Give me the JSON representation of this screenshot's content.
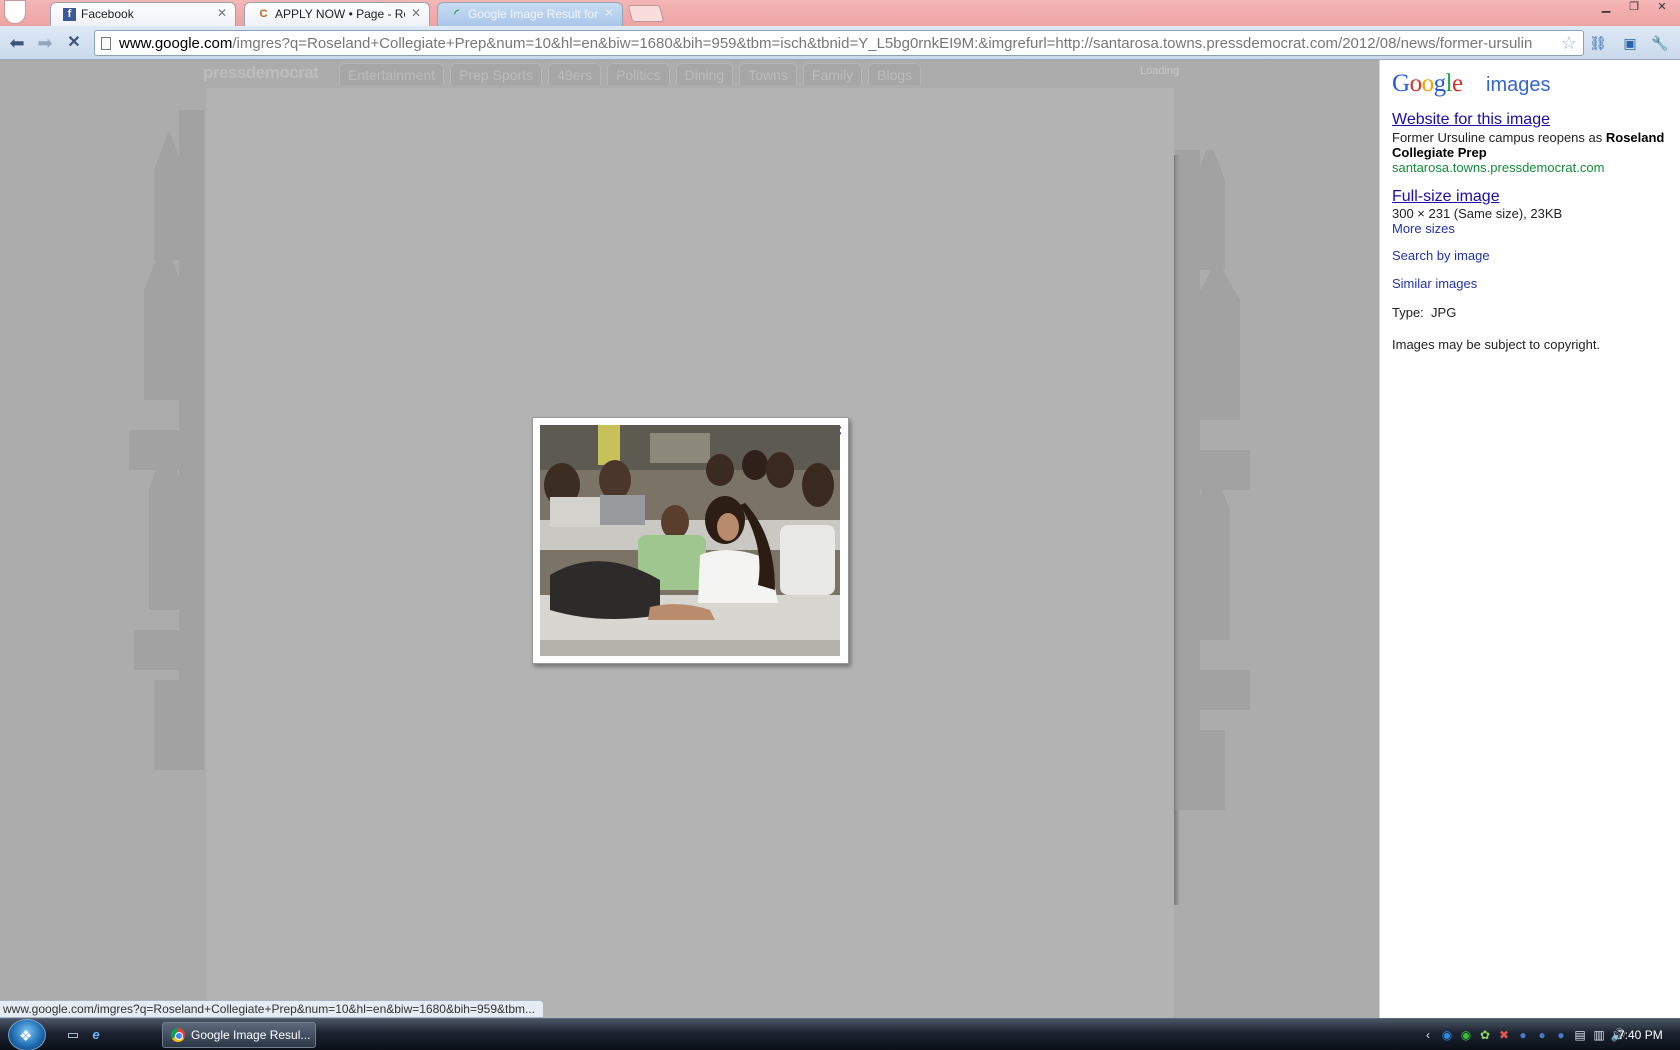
{
  "browser": {
    "tabs": [
      {
        "title": "Facebook",
        "icon": "facebook-icon"
      },
      {
        "title": "APPLY NOW • Page - Rose",
        "icon": "page-favicon-icon"
      },
      {
        "title": "Google Image Result for ht",
        "icon": "loading-spinner-icon"
      }
    ],
    "url_host": "www.google.com",
    "url_path": "/imgres?q=Roseland+Collegiate+Prep&num=10&hl=en&biw=1680&bih=959&tbm=isch&tbnid=Y_L5bg0rnkEI9M:&imgrefurl=http://santarosa.towns.pressdemocrat.com/2012/08/news/former-ursulin"
  },
  "site": {
    "logo": "pressdemocrat",
    "nav": [
      "Entertainment",
      "Prep Sports",
      "49ers",
      "Politics",
      "Dining",
      "Towns",
      "Family",
      "Blogs"
    ],
    "loading": "Loading"
  },
  "preview": {
    "close_label": "×"
  },
  "panel": {
    "logo_letters": [
      "G",
      "o",
      "o",
      "g",
      "l",
      "e"
    ],
    "images_label": "images",
    "website_link": "Website for this image",
    "title_plain": "Former Ursuline campus reopens as ",
    "title_bold": "Roseland Collegiate Prep",
    "source": "santarosa.towns.pressdemocrat.com",
    "fullsize_link": "Full-size image",
    "size_info": "300 × 231 (Same size), 23KB",
    "more_sizes": "More sizes",
    "search_by_image": "Search by image",
    "similar_images": "Similar images",
    "type_info": "Type:  JPG",
    "copyright": "Images may be subject to copyright."
  },
  "status_bar": "www.google.com/imgres?q=Roseland+Collegiate+Prep&num=10&hl=en&biw=1680&bih=959&tbm...",
  "taskbar": {
    "task_label": "Google Image Resul...",
    "clock": "7:40 PM"
  }
}
